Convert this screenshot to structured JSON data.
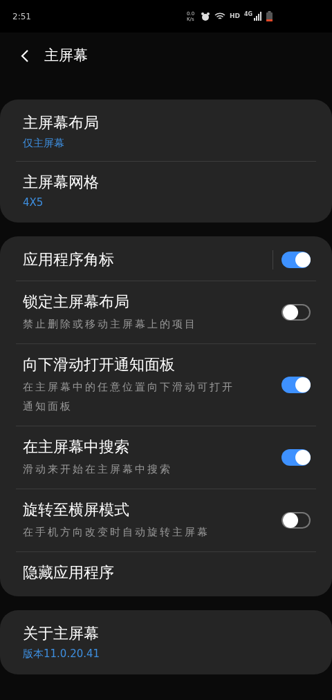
{
  "status_bar": {
    "time": "2:51",
    "speed": "0.0 K/s",
    "network": "HD",
    "generation": "4G"
  },
  "header": {
    "title": "主屏幕"
  },
  "groups": [
    {
      "items": [
        {
          "kind": "link",
          "title": "主屏幕布局",
          "subtitle": "仅主屏幕"
        },
        {
          "kind": "link",
          "title": "主屏幕网格",
          "subtitle": "4X5"
        }
      ]
    },
    {
      "items": [
        {
          "kind": "switch",
          "title": "应用程序角标",
          "on": true,
          "divider": true
        },
        {
          "kind": "switch",
          "title": "锁定主屏幕布局",
          "description": "禁止删除或移动主屏幕上的项目",
          "on": false
        },
        {
          "kind": "switch",
          "title": "向下滑动打开通知面板",
          "description": "在主屏幕中的任意位置向下滑动可打开通知面板",
          "on": true
        },
        {
          "kind": "switch",
          "title": "在主屏幕中搜索",
          "description": "滑动来开始在主屏幕中搜索",
          "on": true
        },
        {
          "kind": "switch",
          "title": "旋转至横屏模式",
          "description": "在手机方向改变时自动旋转主屏幕",
          "on": false
        },
        {
          "kind": "link",
          "title": "隐藏应用程序"
        }
      ]
    },
    {
      "items": [
        {
          "kind": "link",
          "title": "关于主屏幕",
          "subtitle": "版本11.0.20.41"
        }
      ]
    }
  ]
}
